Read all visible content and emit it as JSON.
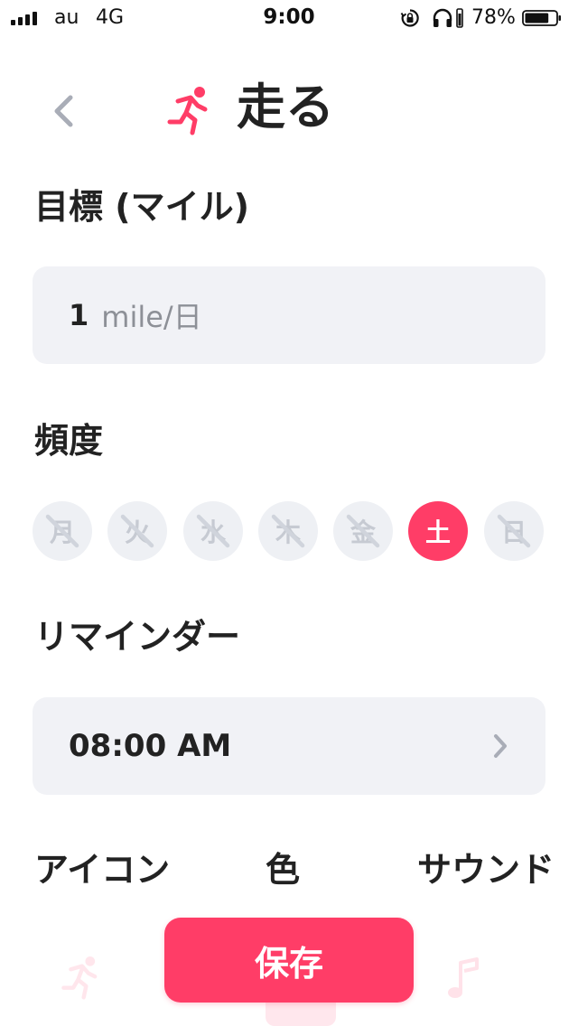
{
  "status_bar": {
    "carrier": "au",
    "network": "4G",
    "time": "9:00",
    "battery_percent": "78%",
    "battery_level": 0.78
  },
  "header": {
    "back_icon": "chevron-left-icon",
    "habit_icon": "runner-icon",
    "title": "走る"
  },
  "goal": {
    "label": "目標 (マイル)",
    "value": "1",
    "unit": "mile/日"
  },
  "frequency": {
    "label": "頻度",
    "days": [
      {
        "label": "月",
        "selected": false
      },
      {
        "label": "火",
        "selected": false
      },
      {
        "label": "水",
        "selected": false
      },
      {
        "label": "木",
        "selected": false
      },
      {
        "label": "金",
        "selected": false
      },
      {
        "label": "土",
        "selected": true
      },
      {
        "label": "日",
        "selected": false
      }
    ]
  },
  "reminder": {
    "label": "リマインダー",
    "time": "08:00 AM",
    "chevron_icon": "chevron-right-icon"
  },
  "appearance": {
    "icon_label": "アイコン",
    "color_label": "色",
    "sound_label": "サウンド"
  },
  "save_button": {
    "label": "保存"
  },
  "colors": {
    "accent": "#ff3d67",
    "card_bg": "#f1f2f6",
    "day_inactive_bg": "#eef0f4",
    "muted_text": "#8d9097",
    "chevron": "#a9adb7"
  }
}
